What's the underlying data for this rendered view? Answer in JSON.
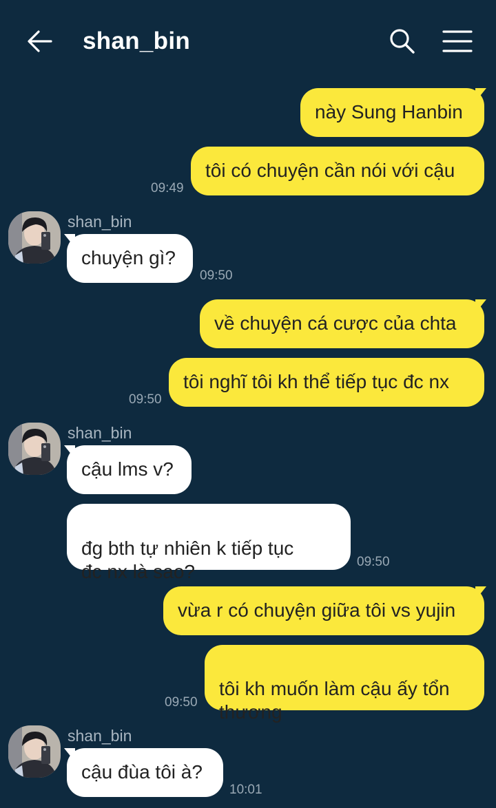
{
  "header": {
    "title": "shan_bin",
    "back_icon": "arrow-left-icon",
    "search_icon": "search-icon",
    "menu_icon": "hamburger-menu-icon"
  },
  "colors": {
    "background": "#0e2a3f",
    "my_bubble": "#fbe83c",
    "their_bubble": "#ffffff"
  },
  "messages": [
    {
      "from": "me",
      "text": "này Sung Hanbin"
    },
    {
      "from": "me",
      "text": "tôi có chuyện cần nói với cậu",
      "time": "09:49"
    },
    {
      "from": "them",
      "sender": "shan_bin",
      "text": "chuyện gì?",
      "time": "09:50"
    },
    {
      "from": "me",
      "text": "về chuyện cá cược của chta"
    },
    {
      "from": "me",
      "text": "tôi nghĩ tôi kh thể tiếp tục đc nx",
      "time": "09:50"
    },
    {
      "from": "them",
      "sender": "shan_bin",
      "text": "cậu lms v?"
    },
    {
      "from": "them",
      "text": "đg bth tự nhiên k tiếp tục\nđc nx là sao?",
      "time": "09:50"
    },
    {
      "from": "me",
      "text": "vừa r có chuyện giữa tôi vs yujin"
    },
    {
      "from": "me",
      "text": "tôi kh muốn làm cậu ấy tổn\nthương",
      "time": "09:50"
    },
    {
      "from": "them",
      "sender": "shan_bin",
      "text": "cậu đùa tôi à?",
      "time": "10:01"
    }
  ]
}
